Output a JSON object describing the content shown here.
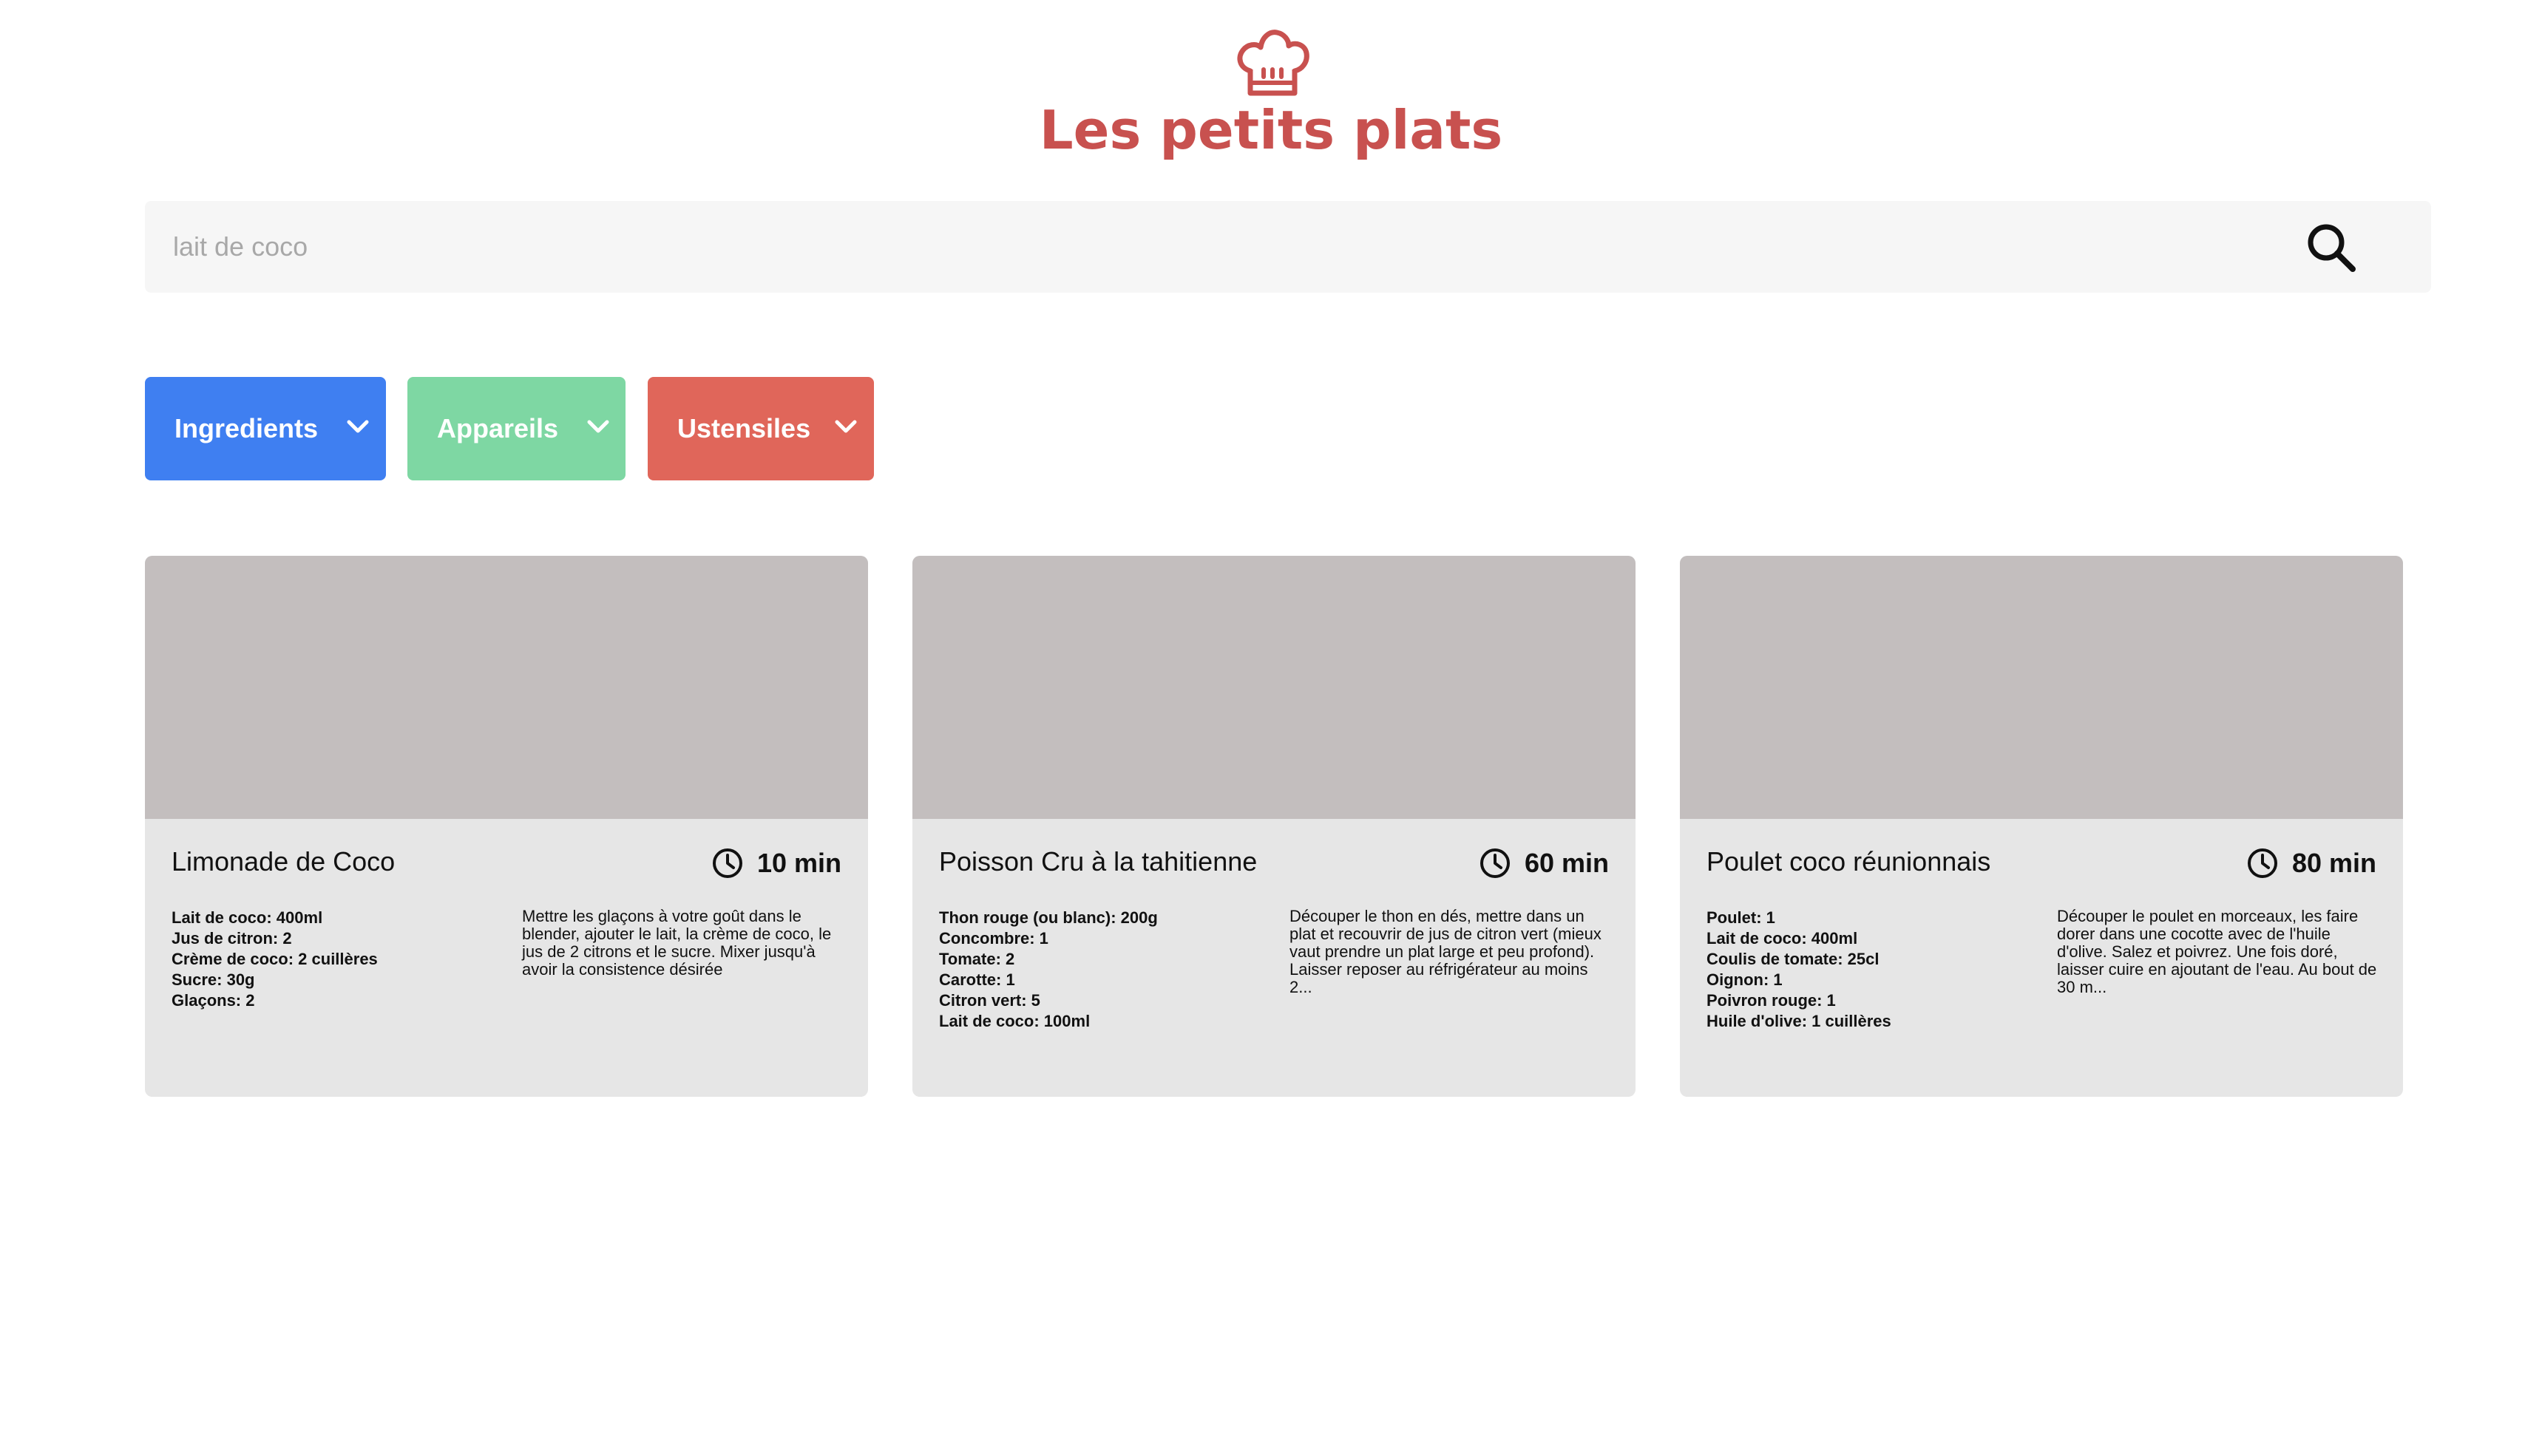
{
  "header": {
    "logo_icon": "chef-hat-icon",
    "title": "Les petits plats"
  },
  "search": {
    "placeholder": "lait de coco",
    "value": "",
    "icon": "search-icon"
  },
  "filters": [
    {
      "label": "Ingredients",
      "color": "#3f7ff1",
      "icon": "chevron-down-icon"
    },
    {
      "label": "Appareils",
      "color": "#7ed7a3",
      "icon": "chevron-down-icon"
    },
    {
      "label": "Ustensiles",
      "color": "#e0665a",
      "icon": "chevron-down-icon"
    }
  ],
  "colors": {
    "brand": "#c8514f",
    "card_bg": "#e6e6e6",
    "image_placeholder": "#c3bebe",
    "search_bg": "#f6f6f6"
  },
  "recipes": [
    {
      "title": "Limonade de Coco",
      "time": "10 min",
      "ingredients": [
        "Lait de coco: 400ml",
        "Jus de citron: 2",
        "Crème de coco: 2 cuillères",
        "Sucre: 30g",
        "Glaçons: 2"
      ],
      "description": "Mettre les glaçons à votre goût dans le blender, ajouter le lait, la crème de coco, le jus de 2 citrons et le sucre. Mixer jusqu'à avoir la consistence désirée"
    },
    {
      "title": "Poisson Cru à la tahitienne",
      "time": "60 min",
      "ingredients": [
        "Thon rouge (ou blanc): 200g",
        "Concombre: 1",
        "Tomate: 2",
        "Carotte: 1",
        "Citron vert: 5",
        "Lait de coco: 100ml"
      ],
      "description": "Découper le thon en dés, mettre dans un plat et recouvrir de jus de citron vert (mieux vaut prendre un plat large et peu profond). Laisser reposer au réfrigérateur au moins 2..."
    },
    {
      "title": "Poulet coco réunionnais",
      "time": "80 min",
      "ingredients": [
        "Poulet: 1",
        "Lait de coco: 400ml",
        "Coulis de tomate: 25cl",
        "Oignon: 1",
        "Poivron rouge: 1",
        "Huile d'olive: 1 cuillères"
      ],
      "description": "Découper le poulet en morceaux, les faire dorer dans une cocotte avec de l'huile d'olive. Salez et poivrez. Une fois doré, laisser cuire en ajoutant de l'eau. Au bout de 30 m..."
    }
  ]
}
